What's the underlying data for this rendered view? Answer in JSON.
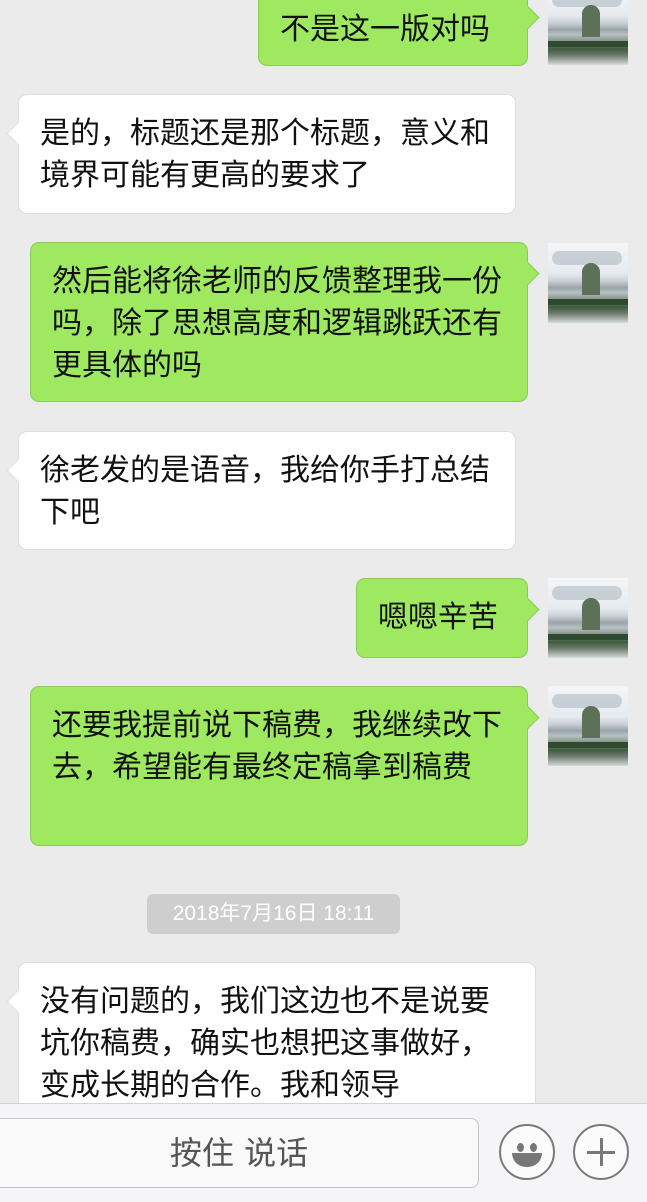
{
  "messages": [
    {
      "sender": "me",
      "text": "不是这一版对吗"
    },
    {
      "sender": "other",
      "text": "是的，标题还是那个标题，意义和境界可能有更高的要求了"
    },
    {
      "sender": "me",
      "text": "然后能将徐老师的反馈整理我一份吗，除了思想高度和逻辑跳跃还有更具体的吗"
    },
    {
      "sender": "other",
      "text": "徐老发的是语音，我给你手打总结下吧"
    },
    {
      "sender": "me",
      "text": "嗯嗯辛苦"
    },
    {
      "sender": "me",
      "text": "还要我提前说下稿费，我继续改下去，希望能有最终定稿拿到稿费"
    },
    {
      "sender": "other",
      "text": "没有问题的，我们这边也不是说要坑你稿费，确实也想把这事做好，变成长期的合作。我和领导"
    }
  ],
  "timestamp": "2018年7月16日 18:11",
  "input_bar": {
    "talk_label": "按住 说话",
    "emoji_icon": "emoji-icon",
    "plus_icon": "plus-icon"
  },
  "colors": {
    "background": "#ebebeb",
    "my_bubble": "#9ee95f",
    "other_bubble": "#ffffff",
    "timestamp_bg": "#cecece"
  }
}
